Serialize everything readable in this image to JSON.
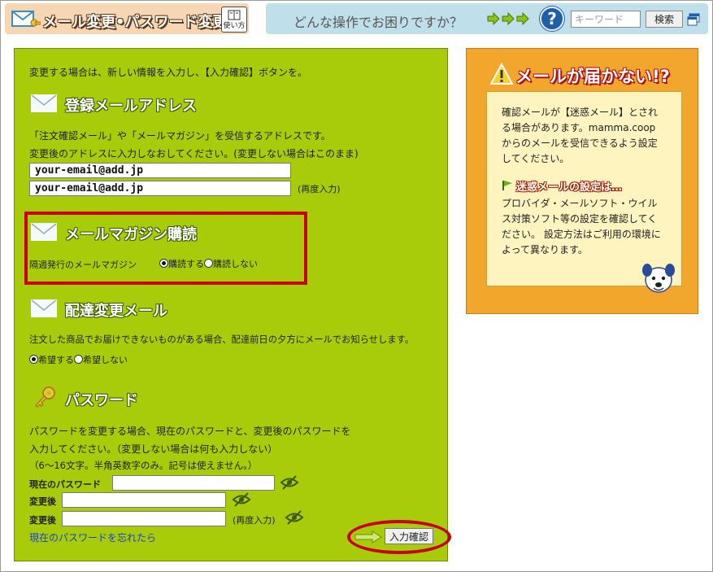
{
  "header": {
    "title": "メール変更•パスワード変更",
    "howto_label": "使い方",
    "question": "どんな操作でお困りですか？",
    "help_icon": "?",
    "search_placeholder": "キーワード",
    "search_button": "検索"
  },
  "main": {
    "intro": "変更する場合は、新しい情報を入力し、【入力確認】ボタンを。",
    "email_section": {
      "title": "登録メールアドレス",
      "desc1": "「注文確認メール」や「メールマガジン」を受信するアドレスです。",
      "desc2": "変更後のアドレスに入力しなおしてください。(変更しない場合はこのまま)",
      "email_value": "your-email@add.jp",
      "email_confirm_value": "your-email@add.jp",
      "confirm_note": "(再度入力)"
    },
    "magazine_section": {
      "title": "メールマガジン購読",
      "label": "隔週発行のメールマガジン",
      "option_yes": "購読する",
      "option_no": "購読しない",
      "selected": "yes"
    },
    "delivery_section": {
      "title": "配達変更メール",
      "desc": "注文した商品でお届けできないものがある場合、配達前日の夕方にメールでお知らせします。",
      "option_yes": "希望する",
      "option_no": "希望しない",
      "selected": "yes"
    },
    "password_section": {
      "title": "パスワード",
      "desc1": "パスワードを変更する場合、現在のパスワードと、変更後のパスワードを",
      "desc2": "入力してください。（変更しない場合は何も入力しない）",
      "desc3": "（6～16文字。半角英数字のみ。記号は使えません。）",
      "current_label": "現在のパスワード",
      "new_label": "変更後",
      "new_confirm_label": "変更後",
      "confirm_note": "(再度入力)",
      "forgot_link": "現在のパスワードを忘れたら"
    },
    "confirm_button": "入力確認"
  },
  "side": {
    "title": "メールが届かない!?",
    "para1_l1": "確認メールが【迷惑メール】とされ",
    "para1_l2": "る場合があります。mamma.coop",
    "para1_l3": "からのメールを受信できるよう設定",
    "para1_l4": "してください。",
    "subhead": "迷惑メールの設定は…",
    "para2_l1": "プロバイダ・メールソフト・ウイル",
    "para2_l2": "ス対策ソフト等の設定を確認してく",
    "para2_l3": "ださい。 設定方法はご利用の環境に",
    "para2_l4": "よって異なります。"
  },
  "colors": {
    "main_bg": "#a8cc0a",
    "side_bg": "#f2a72c",
    "highlight_red": "#cc0000",
    "link": "#1a44c2"
  }
}
